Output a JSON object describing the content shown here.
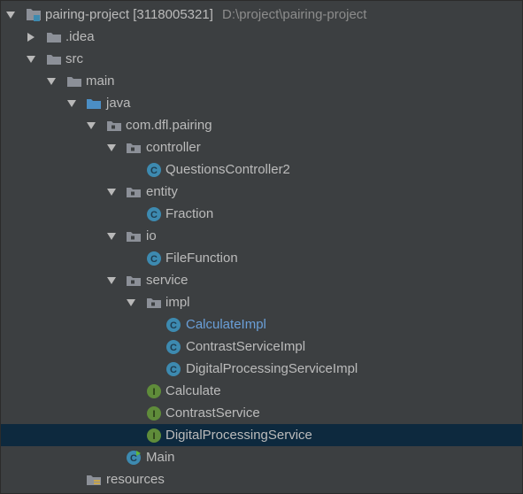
{
  "tree": {
    "root": {
      "name": "pairing-project",
      "badge": "[3118005321]",
      "path": "D:\\project\\pairing-project"
    },
    "idea": "idea",
    "src": "src",
    "main": "main",
    "java": "java",
    "package": "com.dfl.pairing",
    "controller": "controller",
    "questions_controller": "QuestionsController2",
    "entity": "entity",
    "fraction": "Fraction",
    "io": "io",
    "file_function": "FileFunction",
    "service": "service",
    "impl": "impl",
    "calculate_impl": "CalculateImpl",
    "contrast_service_impl": "ContrastServiceImpl",
    "digital_processing_service_impl": "DigitalProcessingServiceImpl",
    "calculate": "Calculate",
    "contrast_service": "ContrastService",
    "digital_processing_service": "DigitalProcessingService",
    "main_class": "Main",
    "resources": "resources"
  },
  "colors": {
    "background": "#3c3f41",
    "text": "#bbbbbb",
    "selected_row": "#0d293e",
    "class_icon": "#3d8ab0",
    "interface_icon": "#5f8c3a",
    "folder": "#8c9098",
    "source_folder": "#4b8ec5",
    "highlight_text": "#6a9fd8"
  }
}
